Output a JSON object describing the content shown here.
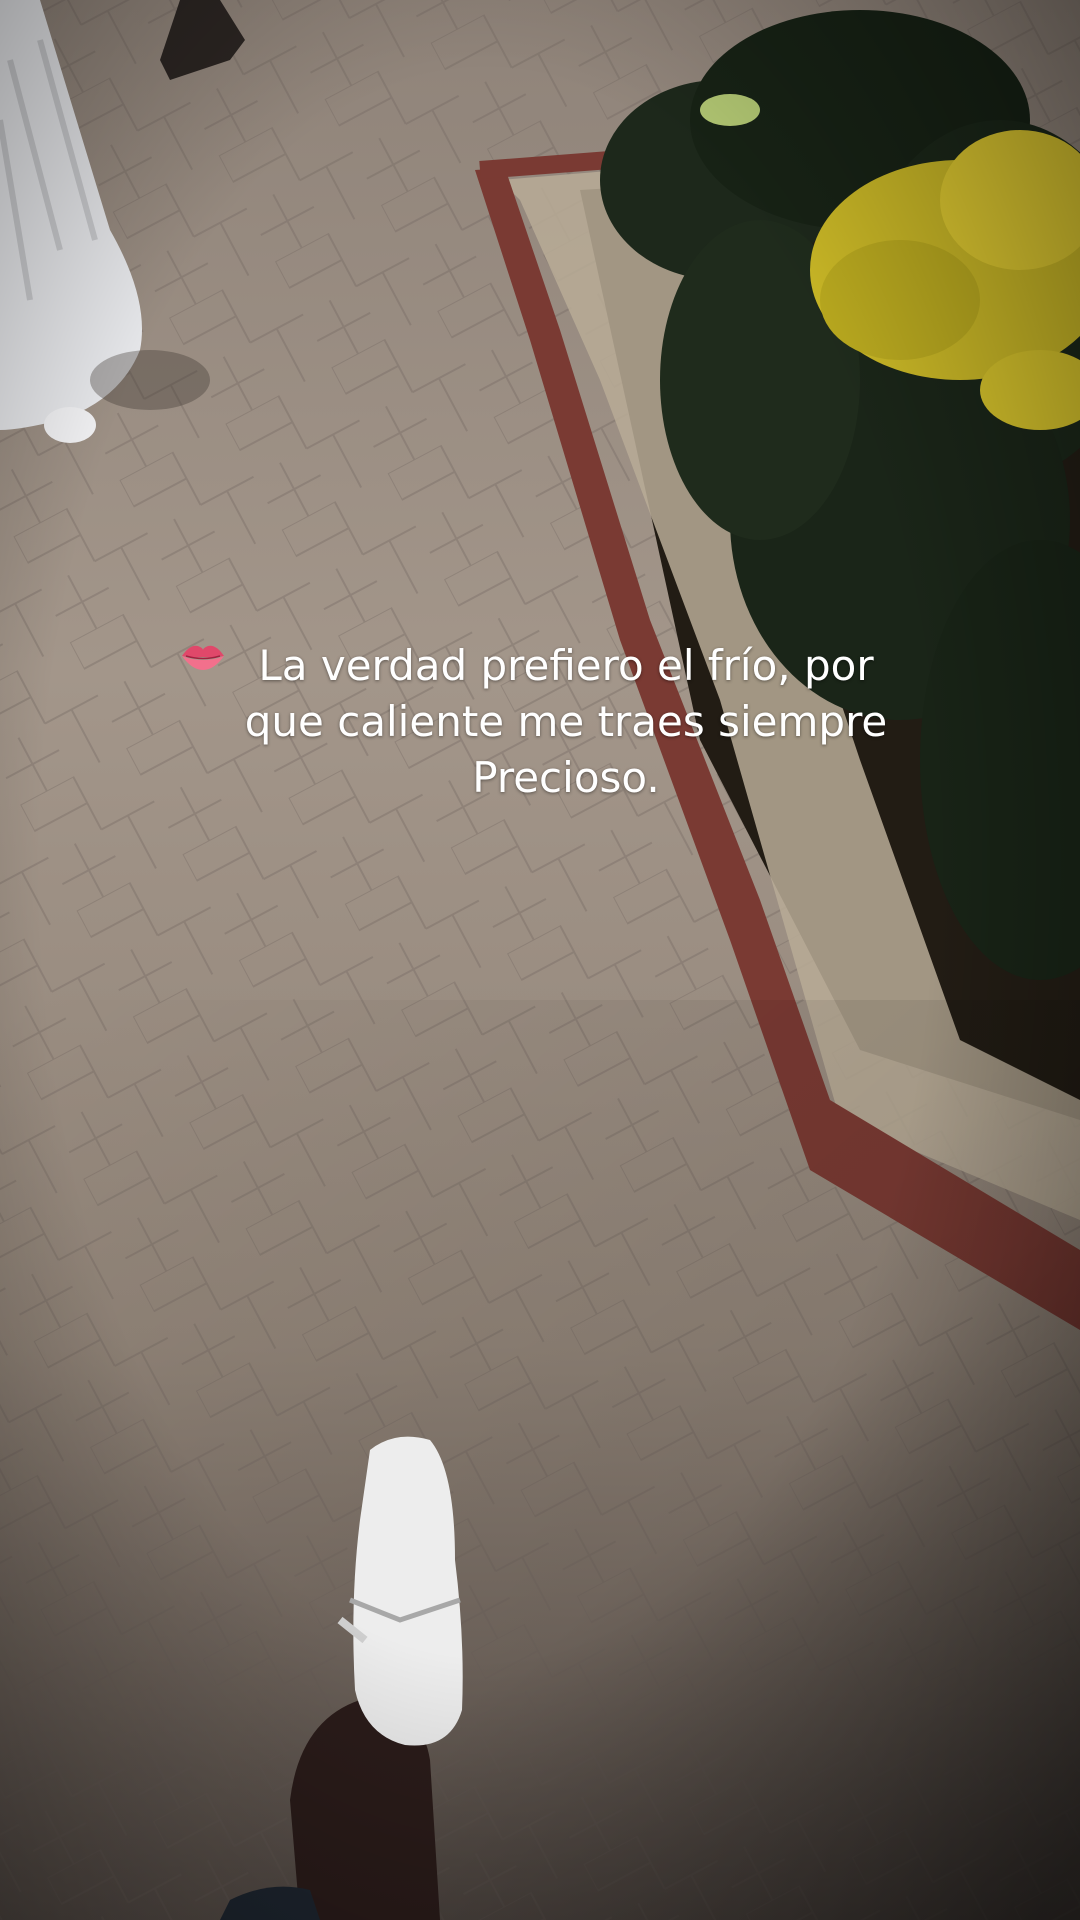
{
  "caption": {
    "line1": "La verdad prefiero el frío, por",
    "line2": "que caliente me traes siempre",
    "line3": "Precioso.",
    "emoji_icon": "lips-icon"
  },
  "scene": {
    "description_icons": [
      "white-planter",
      "flower-bed",
      "white-sneaker"
    ],
    "colors": {
      "pavement": "#9d8f84",
      "border_brick": "#7a3a33",
      "shrubs": "#1e2a1c",
      "yellow_flowers": "#d9c62a",
      "sneaker": "#eeeeee"
    }
  }
}
